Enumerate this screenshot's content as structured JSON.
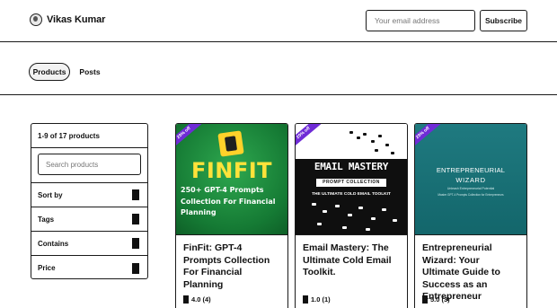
{
  "header": {
    "brand_name": "Vikas Kumar",
    "avatar_icon": "avatar-icon",
    "email_placeholder": "Your email address",
    "subscribe_label": "Subscribe"
  },
  "tabs": [
    {
      "label": "Products",
      "active": true
    },
    {
      "label": "Posts",
      "active": false
    }
  ],
  "filters": {
    "count_text": "1-9 of 17 products",
    "search_placeholder": "Search products",
    "rows": [
      {
        "label": "Sort by",
        "icon": "chevron-down-icon"
      },
      {
        "label": "Tags",
        "icon": "chevron-down-icon"
      },
      {
        "label": "Contains",
        "icon": "chevron-down-icon"
      },
      {
        "label": "Price",
        "icon": "chevron-down-icon"
      }
    ]
  },
  "products": [
    {
      "title": "FinFit: GPT-4 Prompts Collection For Financial Planning",
      "rating": "4.0 (4)",
      "badge": "20% off",
      "cover": {
        "headline": "FINFIT",
        "subline": "250+ GPT-4 Prompts Collection For Financial Planning",
        "color": "#157a34"
      }
    },
    {
      "title": "Email Mastery: The Ultimate Cold Email Toolkit.",
      "rating": "1.0 (1)",
      "badge": "20% off",
      "cover": {
        "headline": "EMAIL MASTERY",
        "tag": "PROMPT COLLECTION",
        "subline": "THE ULTIMATE COLD EMAIL TOOLKIT",
        "color": "#0f0f0f"
      }
    },
    {
      "title": "Entrepreneurial Wizard: Your Ultimate Guide to Success as an Entrepreneur",
      "rating": "5.0 (3)",
      "badge": "20% off",
      "cover": {
        "headline": "ENTREPRENEURIAL",
        "headline2": "WIZARD",
        "subline": "Unleash Entrepreneurial Potential",
        "subline2": "Master GPT-4 Prompts Collection for Entrepreneurs",
        "color": "#1f7a80"
      }
    }
  ]
}
